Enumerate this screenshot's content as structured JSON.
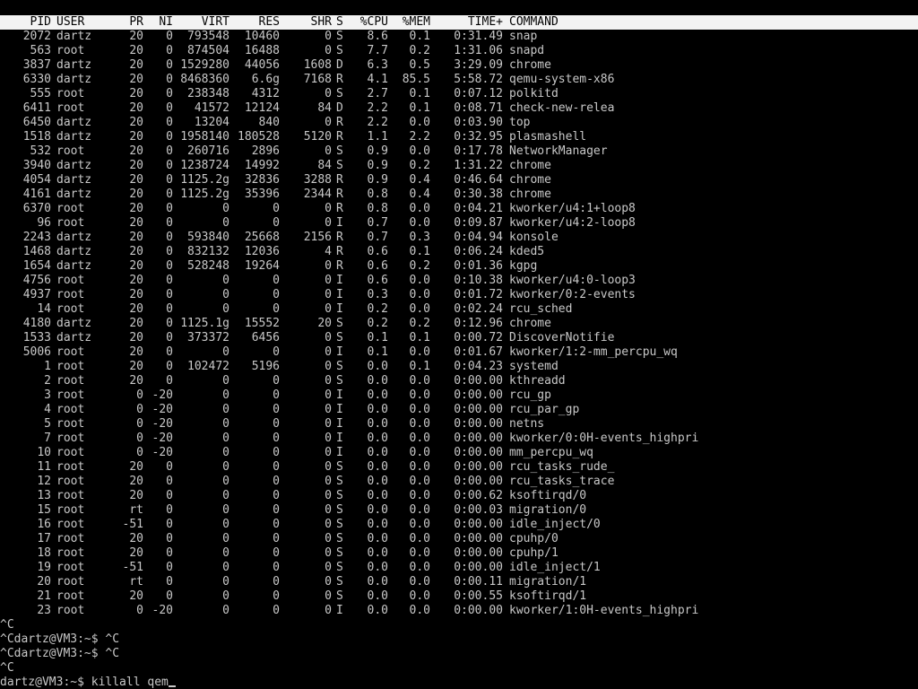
{
  "header": {
    "pid": "PID",
    "user": "USER",
    "pr": "PR",
    "ni": "NI",
    "virt": "VIRT",
    "res": "RES",
    "shr": "SHR",
    "s": "S",
    "cpu": "%CPU",
    "mem": "%MEM",
    "time": "TIME+",
    "command": "COMMAND"
  },
  "processes": [
    {
      "pid": "2072",
      "user": "dartz",
      "pr": "20",
      "ni": "0",
      "virt": "793548",
      "res": "10460",
      "shr": "0",
      "s": "S",
      "cpu": "8.6",
      "mem": "0.1",
      "time": "0:31.49",
      "command": "snap"
    },
    {
      "pid": "563",
      "user": "root",
      "pr": "20",
      "ni": "0",
      "virt": "874504",
      "res": "16488",
      "shr": "0",
      "s": "S",
      "cpu": "7.7",
      "mem": "0.2",
      "time": "1:31.06",
      "command": "snapd"
    },
    {
      "pid": "3837",
      "user": "dartz",
      "pr": "20",
      "ni": "0",
      "virt": "1529280",
      "res": "44056",
      "shr": "1608",
      "s": "D",
      "cpu": "6.3",
      "mem": "0.5",
      "time": "3:29.09",
      "command": "chrome"
    },
    {
      "pid": "6330",
      "user": "dartz",
      "pr": "20",
      "ni": "0",
      "virt": "8468360",
      "res": "6.6g",
      "shr": "7168",
      "s": "R",
      "cpu": "4.1",
      "mem": "85.5",
      "time": "5:58.72",
      "command": "qemu-system-x86"
    },
    {
      "pid": "555",
      "user": "root",
      "pr": "20",
      "ni": "0",
      "virt": "238348",
      "res": "4312",
      "shr": "0",
      "s": "S",
      "cpu": "2.7",
      "mem": "0.1",
      "time": "0:07.12",
      "command": "polkitd"
    },
    {
      "pid": "6411",
      "user": "root",
      "pr": "20",
      "ni": "0",
      "virt": "41572",
      "res": "12124",
      "shr": "84",
      "s": "D",
      "cpu": "2.2",
      "mem": "0.1",
      "time": "0:08.71",
      "command": "check-new-relea"
    },
    {
      "pid": "6450",
      "user": "dartz",
      "pr": "20",
      "ni": "0",
      "virt": "13204",
      "res": "840",
      "shr": "0",
      "s": "R",
      "cpu": "2.2",
      "mem": "0.0",
      "time": "0:03.90",
      "command": "top"
    },
    {
      "pid": "1518",
      "user": "dartz",
      "pr": "20",
      "ni": "0",
      "virt": "1958140",
      "res": "180528",
      "shr": "5120",
      "s": "R",
      "cpu": "1.1",
      "mem": "2.2",
      "time": "0:32.95",
      "command": "plasmashell"
    },
    {
      "pid": "532",
      "user": "root",
      "pr": "20",
      "ni": "0",
      "virt": "260716",
      "res": "2896",
      "shr": "0",
      "s": "S",
      "cpu": "0.9",
      "mem": "0.0",
      "time": "0:17.78",
      "command": "NetworkManager"
    },
    {
      "pid": "3940",
      "user": "dartz",
      "pr": "20",
      "ni": "0",
      "virt": "1238724",
      "res": "14992",
      "shr": "84",
      "s": "S",
      "cpu": "0.9",
      "mem": "0.2",
      "time": "1:31.22",
      "command": "chrome"
    },
    {
      "pid": "4054",
      "user": "dartz",
      "pr": "20",
      "ni": "0",
      "virt": "1125.2g",
      "res": "32836",
      "shr": "3288",
      "s": "R",
      "cpu": "0.9",
      "mem": "0.4",
      "time": "0:46.64",
      "command": "chrome"
    },
    {
      "pid": "4161",
      "user": "dartz",
      "pr": "20",
      "ni": "0",
      "virt": "1125.2g",
      "res": "35396",
      "shr": "2344",
      "s": "R",
      "cpu": "0.8",
      "mem": "0.4",
      "time": "0:30.38",
      "command": "chrome"
    },
    {
      "pid": "6370",
      "user": "root",
      "pr": "20",
      "ni": "0",
      "virt": "0",
      "res": "0",
      "shr": "0",
      "s": "R",
      "cpu": "0.8",
      "mem": "0.0",
      "time": "0:04.21",
      "command": "kworker/u4:1+loop8"
    },
    {
      "pid": "96",
      "user": "root",
      "pr": "20",
      "ni": "0",
      "virt": "0",
      "res": "0",
      "shr": "0",
      "s": "I",
      "cpu": "0.7",
      "mem": "0.0",
      "time": "0:09.87",
      "command": "kworker/u4:2-loop8"
    },
    {
      "pid": "2243",
      "user": "dartz",
      "pr": "20",
      "ni": "0",
      "virt": "593840",
      "res": "25668",
      "shr": "2156",
      "s": "R",
      "cpu": "0.7",
      "mem": "0.3",
      "time": "0:04.94",
      "command": "konsole"
    },
    {
      "pid": "1468",
      "user": "dartz",
      "pr": "20",
      "ni": "0",
      "virt": "832132",
      "res": "12036",
      "shr": "4",
      "s": "R",
      "cpu": "0.6",
      "mem": "0.1",
      "time": "0:06.24",
      "command": "kded5"
    },
    {
      "pid": "1654",
      "user": "dartz",
      "pr": "20",
      "ni": "0",
      "virt": "528248",
      "res": "19264",
      "shr": "0",
      "s": "R",
      "cpu": "0.6",
      "mem": "0.2",
      "time": "0:01.36",
      "command": "kgpg"
    },
    {
      "pid": "4756",
      "user": "root",
      "pr": "20",
      "ni": "0",
      "virt": "0",
      "res": "0",
      "shr": "0",
      "s": "I",
      "cpu": "0.6",
      "mem": "0.0",
      "time": "0:10.38",
      "command": "kworker/u4:0-loop3"
    },
    {
      "pid": "4937",
      "user": "root",
      "pr": "20",
      "ni": "0",
      "virt": "0",
      "res": "0",
      "shr": "0",
      "s": "I",
      "cpu": "0.3",
      "mem": "0.0",
      "time": "0:01.72",
      "command": "kworker/0:2-events"
    },
    {
      "pid": "14",
      "user": "root",
      "pr": "20",
      "ni": "0",
      "virt": "0",
      "res": "0",
      "shr": "0",
      "s": "I",
      "cpu": "0.2",
      "mem": "0.0",
      "time": "0:02.24",
      "command": "rcu_sched"
    },
    {
      "pid": "4180",
      "user": "dartz",
      "pr": "20",
      "ni": "0",
      "virt": "1125.1g",
      "res": "15552",
      "shr": "20",
      "s": "S",
      "cpu": "0.2",
      "mem": "0.2",
      "time": "0:12.96",
      "command": "chrome"
    },
    {
      "pid": "1533",
      "user": "dartz",
      "pr": "20",
      "ni": "0",
      "virt": "373372",
      "res": "6456",
      "shr": "0",
      "s": "S",
      "cpu": "0.1",
      "mem": "0.1",
      "time": "0:00.72",
      "command": "DiscoverNotifie"
    },
    {
      "pid": "5006",
      "user": "root",
      "pr": "20",
      "ni": "0",
      "virt": "0",
      "res": "0",
      "shr": "0",
      "s": "I",
      "cpu": "0.1",
      "mem": "0.0",
      "time": "0:01.67",
      "command": "kworker/1:2-mm_percpu_wq"
    },
    {
      "pid": "1",
      "user": "root",
      "pr": "20",
      "ni": "0",
      "virt": "102472",
      "res": "5196",
      "shr": "0",
      "s": "S",
      "cpu": "0.0",
      "mem": "0.1",
      "time": "0:04.23",
      "command": "systemd"
    },
    {
      "pid": "2",
      "user": "root",
      "pr": "20",
      "ni": "0",
      "virt": "0",
      "res": "0",
      "shr": "0",
      "s": "S",
      "cpu": "0.0",
      "mem": "0.0",
      "time": "0:00.00",
      "command": "kthreadd"
    },
    {
      "pid": "3",
      "user": "root",
      "pr": "0",
      "ni": "-20",
      "virt": "0",
      "res": "0",
      "shr": "0",
      "s": "I",
      "cpu": "0.0",
      "mem": "0.0",
      "time": "0:00.00",
      "command": "rcu_gp"
    },
    {
      "pid": "4",
      "user": "root",
      "pr": "0",
      "ni": "-20",
      "virt": "0",
      "res": "0",
      "shr": "0",
      "s": "I",
      "cpu": "0.0",
      "mem": "0.0",
      "time": "0:00.00",
      "command": "rcu_par_gp"
    },
    {
      "pid": "5",
      "user": "root",
      "pr": "0",
      "ni": "-20",
      "virt": "0",
      "res": "0",
      "shr": "0",
      "s": "I",
      "cpu": "0.0",
      "mem": "0.0",
      "time": "0:00.00",
      "command": "netns"
    },
    {
      "pid": "7",
      "user": "root",
      "pr": "0",
      "ni": "-20",
      "virt": "0",
      "res": "0",
      "shr": "0",
      "s": "I",
      "cpu": "0.0",
      "mem": "0.0",
      "time": "0:00.00",
      "command": "kworker/0:0H-events_highpri"
    },
    {
      "pid": "10",
      "user": "root",
      "pr": "0",
      "ni": "-20",
      "virt": "0",
      "res": "0",
      "shr": "0",
      "s": "I",
      "cpu": "0.0",
      "mem": "0.0",
      "time": "0:00.00",
      "command": "mm_percpu_wq"
    },
    {
      "pid": "11",
      "user": "root",
      "pr": "20",
      "ni": "0",
      "virt": "0",
      "res": "0",
      "shr": "0",
      "s": "S",
      "cpu": "0.0",
      "mem": "0.0",
      "time": "0:00.00",
      "command": "rcu_tasks_rude_"
    },
    {
      "pid": "12",
      "user": "root",
      "pr": "20",
      "ni": "0",
      "virt": "0",
      "res": "0",
      "shr": "0",
      "s": "S",
      "cpu": "0.0",
      "mem": "0.0",
      "time": "0:00.00",
      "command": "rcu_tasks_trace"
    },
    {
      "pid": "13",
      "user": "root",
      "pr": "20",
      "ni": "0",
      "virt": "0",
      "res": "0",
      "shr": "0",
      "s": "S",
      "cpu": "0.0",
      "mem": "0.0",
      "time": "0:00.62",
      "command": "ksoftirqd/0"
    },
    {
      "pid": "15",
      "user": "root",
      "pr": "rt",
      "ni": "0",
      "virt": "0",
      "res": "0",
      "shr": "0",
      "s": "S",
      "cpu": "0.0",
      "mem": "0.0",
      "time": "0:00.03",
      "command": "migration/0"
    },
    {
      "pid": "16",
      "user": "root",
      "pr": "-51",
      "ni": "0",
      "virt": "0",
      "res": "0",
      "shr": "0",
      "s": "S",
      "cpu": "0.0",
      "mem": "0.0",
      "time": "0:00.00",
      "command": "idle_inject/0"
    },
    {
      "pid": "17",
      "user": "root",
      "pr": "20",
      "ni": "0",
      "virt": "0",
      "res": "0",
      "shr": "0",
      "s": "S",
      "cpu": "0.0",
      "mem": "0.0",
      "time": "0:00.00",
      "command": "cpuhp/0"
    },
    {
      "pid": "18",
      "user": "root",
      "pr": "20",
      "ni": "0",
      "virt": "0",
      "res": "0",
      "shr": "0",
      "s": "S",
      "cpu": "0.0",
      "mem": "0.0",
      "time": "0:00.00",
      "command": "cpuhp/1"
    },
    {
      "pid": "19",
      "user": "root",
      "pr": "-51",
      "ni": "0",
      "virt": "0",
      "res": "0",
      "shr": "0",
      "s": "S",
      "cpu": "0.0",
      "mem": "0.0",
      "time": "0:00.00",
      "command": "idle_inject/1"
    },
    {
      "pid": "20",
      "user": "root",
      "pr": "rt",
      "ni": "0",
      "virt": "0",
      "res": "0",
      "shr": "0",
      "s": "S",
      "cpu": "0.0",
      "mem": "0.0",
      "time": "0:00.11",
      "command": "migration/1"
    },
    {
      "pid": "21",
      "user": "root",
      "pr": "20",
      "ni": "0",
      "virt": "0",
      "res": "0",
      "shr": "0",
      "s": "S",
      "cpu": "0.0",
      "mem": "0.0",
      "time": "0:00.55",
      "command": "ksoftirqd/1"
    },
    {
      "pid": "23",
      "user": "root",
      "pr": "0",
      "ni": "-20",
      "virt": "0",
      "res": "0",
      "shr": "0",
      "s": "I",
      "cpu": "0.0",
      "mem": "0.0",
      "time": "0:00.00",
      "command": "kworker/1:0H-events_highpri"
    }
  ],
  "shell": {
    "lines": [
      "^C",
      "^Cdartz@VM3:~$ ^C",
      "^Cdartz@VM3:~$ ^C",
      "^C"
    ],
    "prompt": "dartz@VM3:~$ ",
    "current_input": "killall qem"
  }
}
